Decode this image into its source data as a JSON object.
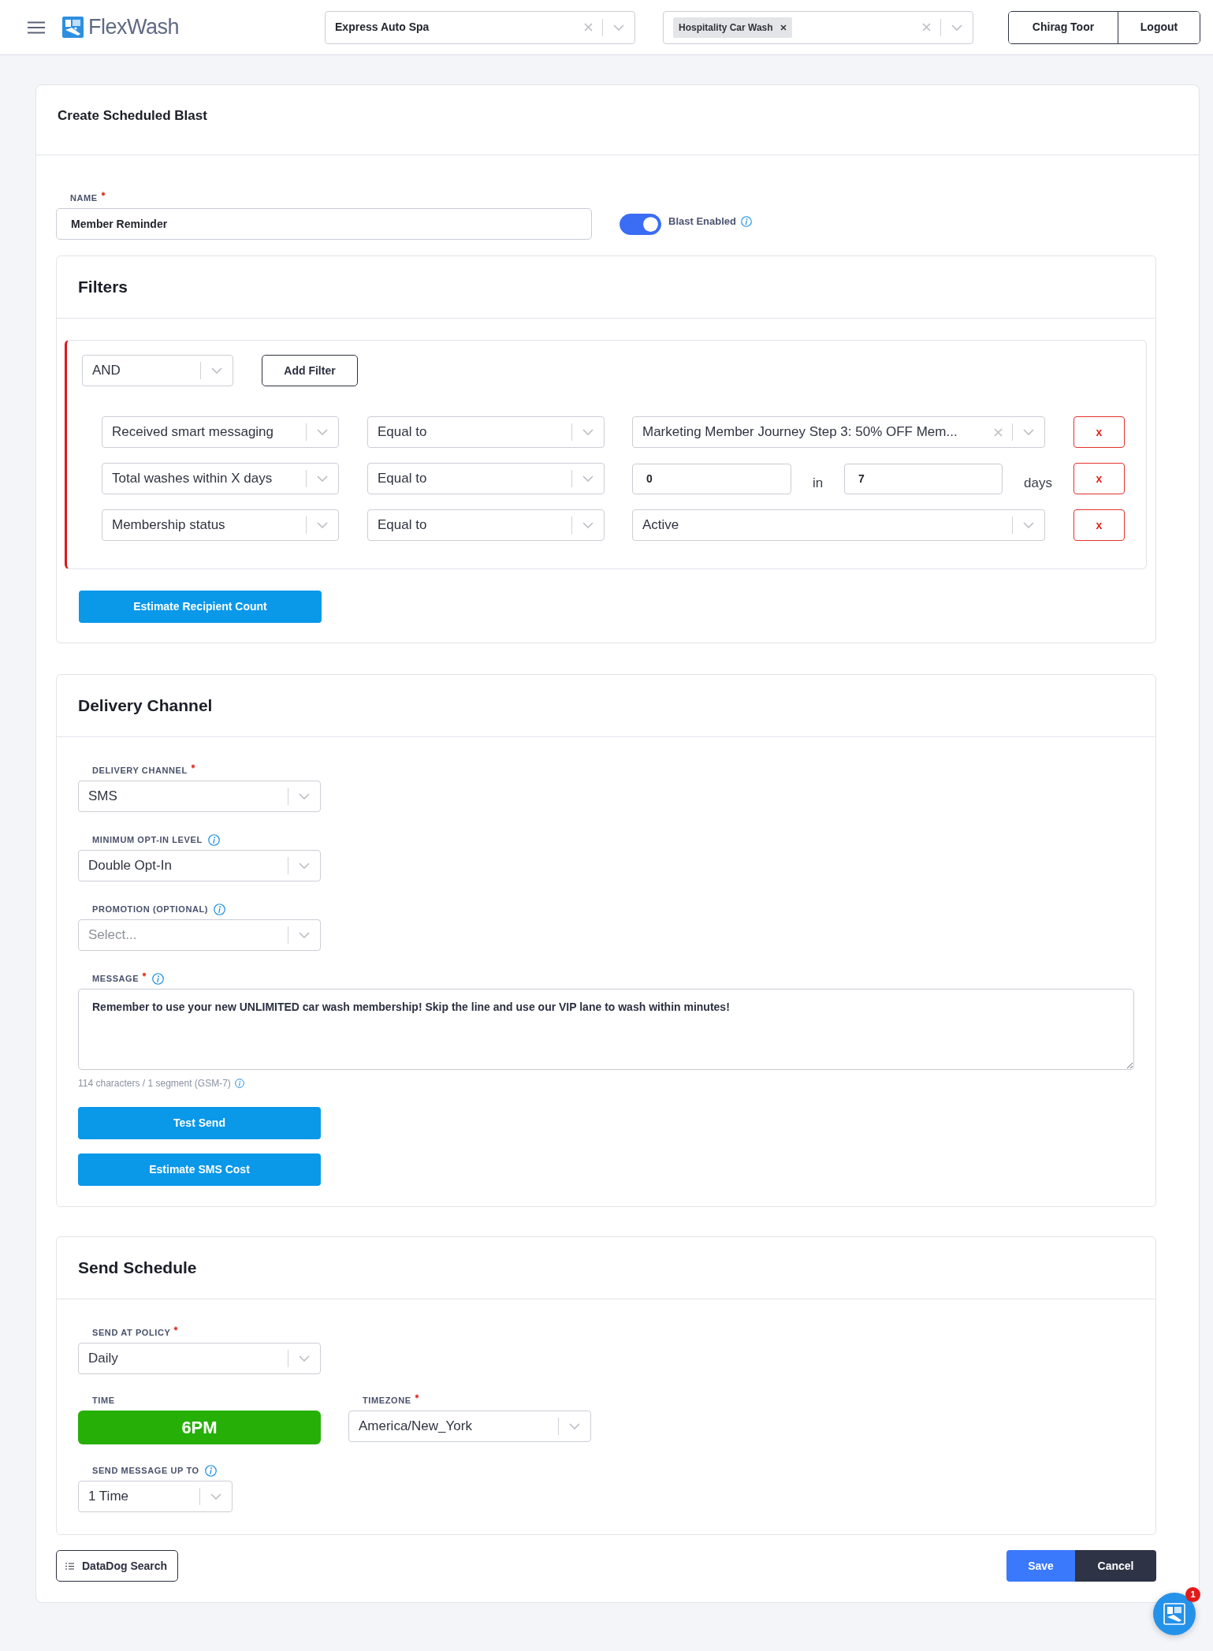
{
  "header": {
    "brand": "FlexWash",
    "location_select": {
      "value": "Express Auto Spa",
      "clearable": true
    },
    "site_select": {
      "tags": [
        {
          "label": "Hospitality Car Wash"
        }
      ],
      "clearable": true
    },
    "user_buttons": [
      "Chirag Toor",
      "Logout"
    ]
  },
  "form": {
    "title": "Create Scheduled Blast",
    "name_field": {
      "label": "NAME",
      "required": true,
      "value": "Member Reminder"
    },
    "blast_toggle": {
      "label": "Blast Enabled",
      "on": true,
      "info": true
    },
    "filters": {
      "title": "Filters",
      "operator": "AND",
      "add_button": "Add Filter",
      "rows": [
        {
          "kind": "select",
          "field": "Received smart messaging",
          "comparator": "Equal to",
          "value": "Marketing Member Journey Step 3: 50% OFF Mem...",
          "clearable": true,
          "remove": "x"
        },
        {
          "kind": "range",
          "field": "Total washes within X days",
          "comparator": "Equal to",
          "value": "0",
          "joiner": "in",
          "days_value": "7",
          "unit": "days",
          "remove": "x"
        },
        {
          "kind": "select",
          "field": "Membership status",
          "comparator": "Equal to",
          "value": "Active",
          "clearable": false,
          "remove": "x"
        }
      ],
      "estimate_button": "Estimate Recipient Count"
    },
    "delivery": {
      "title": "Delivery Channel",
      "fields": [
        {
          "kind": "select",
          "label": "DELIVERY CHANNEL",
          "required": true,
          "info": false,
          "value": "SMS"
        },
        {
          "kind": "select",
          "label": "MINIMUM OPT-IN LEVEL",
          "required": false,
          "info": true,
          "value": "Double Opt-In"
        },
        {
          "kind": "select",
          "label": "PROMOTION (OPTIONAL)",
          "required": false,
          "info": true,
          "placeholder": "Select..."
        },
        {
          "kind": "textarea",
          "label": "MESSAGE",
          "required": true,
          "info": true,
          "value": "Remember to use your new UNLIMITED car wash membership! Skip the line and use our VIP lane to wash within minutes!",
          "counter": "114 characters / 1 segment (GSM-7)",
          "counter_info": true
        }
      ],
      "buttons": [
        "Test Send",
        "Estimate SMS Cost"
      ]
    },
    "schedule": {
      "title": "Send Schedule",
      "rows": [
        {
          "fields": [
            {
              "kind": "select",
              "label": "SEND AT POLICY",
              "required": true,
              "info": false,
              "value": "Daily"
            }
          ]
        },
        {
          "fields": [
            {
              "kind": "time",
              "label": "TIME",
              "required": false,
              "info": false,
              "value": "6PM"
            },
            {
              "kind": "select",
              "label": "TIMEZONE",
              "required": true,
              "info": false,
              "value": "America/New_York"
            }
          ]
        },
        {
          "fields": [
            {
              "kind": "select",
              "label": "SEND MESSAGE UP TO",
              "required": false,
              "info": true,
              "value": "1 Time"
            }
          ]
        }
      ]
    },
    "footer": {
      "search_button": "DataDog Search",
      "save_button": "Save",
      "cancel_button": "Cancel"
    }
  },
  "chat": {
    "badge": "1"
  }
}
